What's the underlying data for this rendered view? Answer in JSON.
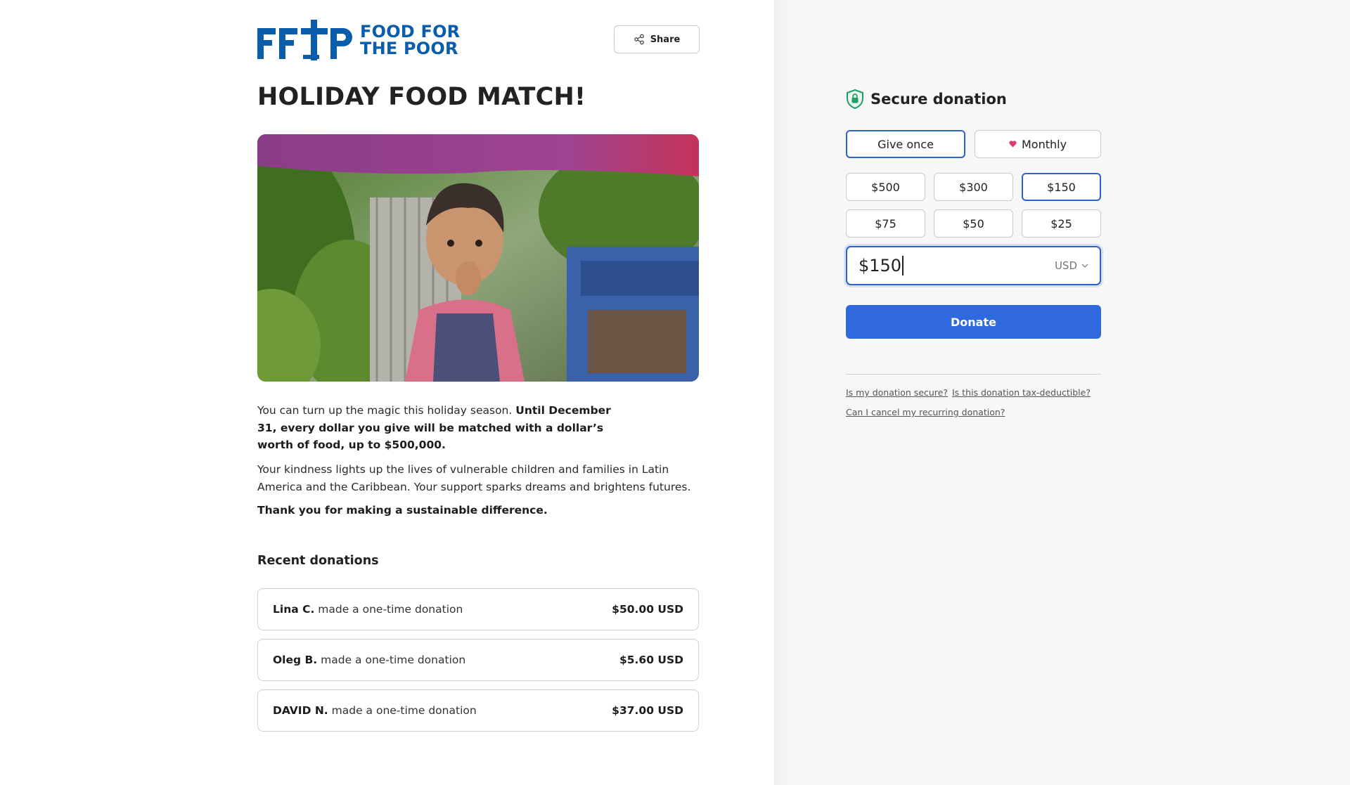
{
  "brand": {
    "logo_text": "FFTP",
    "name_line1": "FOOD FOR",
    "name_line2": "THE POOR",
    "color": "#0a5dab"
  },
  "header": {
    "share_label": "Share",
    "share_icon": "share-icon"
  },
  "campaign": {
    "title": "HOLIDAY FOOD MATCH!",
    "image_desc": "child-photo",
    "para1_normal": "You can turn up the magic this holiday season. ",
    "para1_bold": "Until December 31, every dollar you give will be matched with a dollar’s worth of food, up to $500,000.",
    "para2": "Your kindness lights up the lives of vulnerable children and families in Latin America and the Caribbean. Your support sparks dreams and brightens futures.",
    "para3": "Thank you for making a sustainable difference."
  },
  "recent": {
    "title": "Recent donations",
    "items": [
      {
        "name": "Lina C.",
        "text": "made a one-time donation",
        "amount": "$50.00 USD"
      },
      {
        "name": "Oleg B.",
        "text": "made a one-time donation",
        "amount": "$5.60 USD"
      },
      {
        "name": "DAVID N.",
        "text": "made a one-time donation",
        "amount": "$37.00 USD"
      }
    ]
  },
  "form": {
    "secure_label": "Secure donation",
    "frequency": {
      "once": "Give once",
      "monthly": "Monthly",
      "selected": "once"
    },
    "amounts": [
      "$500",
      "$300",
      "$150",
      "$75",
      "$50",
      "$25"
    ],
    "selected_amount": "$150",
    "input_value": "$150",
    "currency": "USD",
    "donate_label": "Donate",
    "accent": "#2f69dd",
    "faq": {
      "secure": "Is my donation secure?",
      "tax": "Is this donation tax-deductible?",
      "cancel": "Can I cancel my recurring donation?"
    }
  }
}
